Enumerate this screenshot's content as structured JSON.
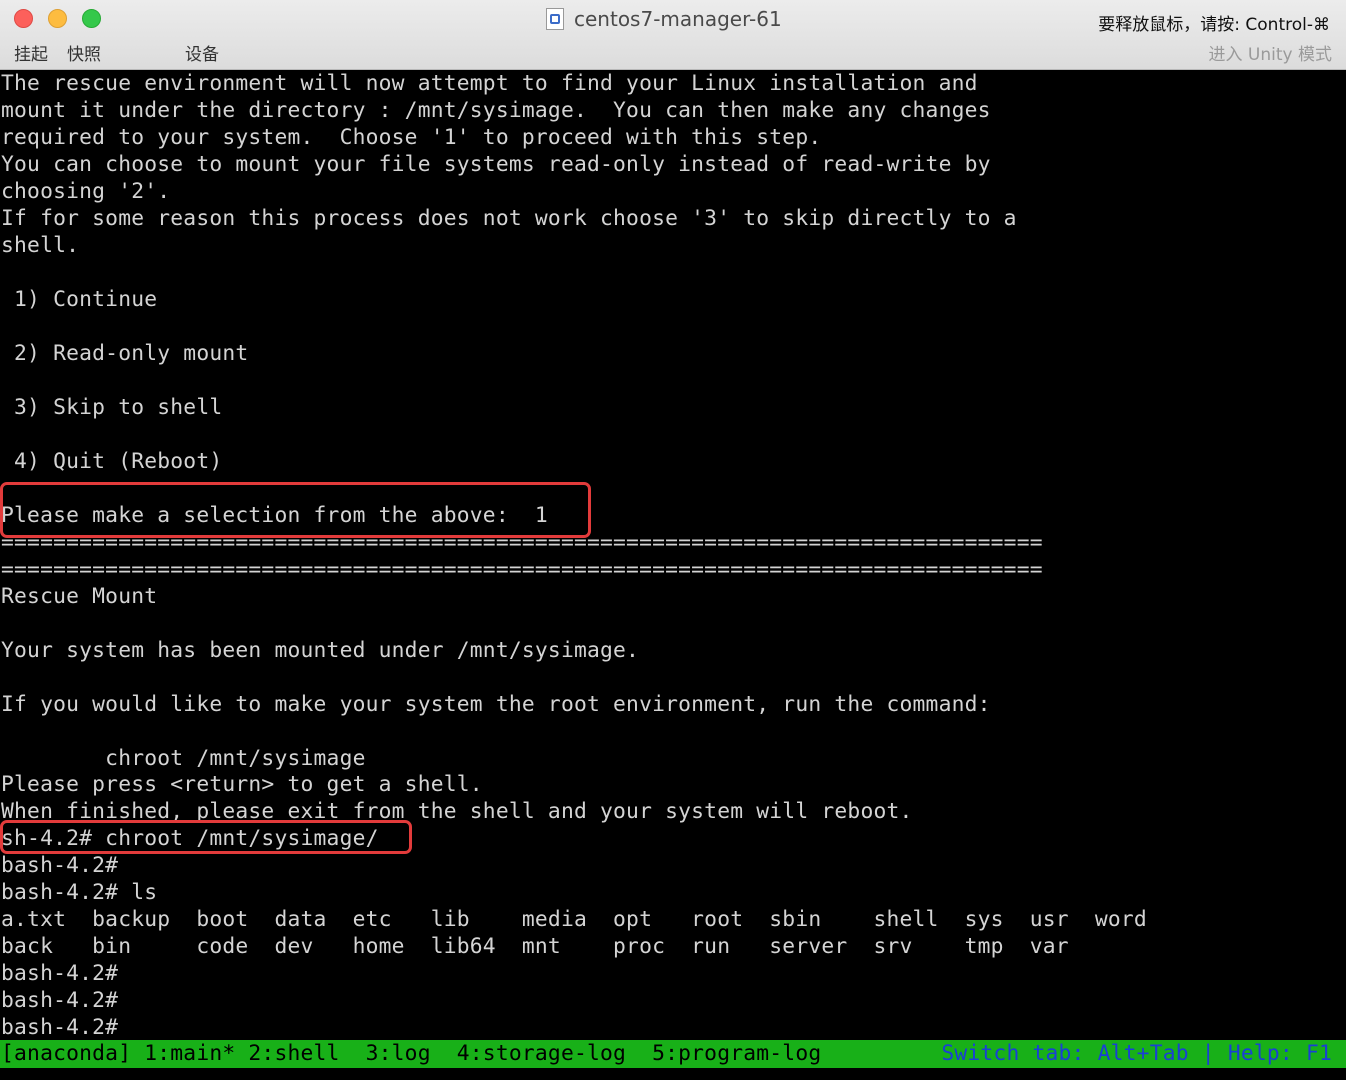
{
  "window": {
    "title": "centos7-manager-61",
    "release_hint": "要释放鼠标，请按: Control-⌘",
    "menu": [
      "挂起",
      "快照",
      "设备"
    ],
    "unity_mode": "进入 Unity 模式"
  },
  "terminal": {
    "lines": [
      "The rescue environment will now attempt to find your Linux installation and",
      "mount it under the directory : /mnt/sysimage.  You can then make any changes",
      "required to your system.  Choose '1' to proceed with this step.",
      "You can choose to mount your file systems read-only instead of read-write by",
      "choosing '2'.",
      "If for some reason this process does not work choose '3' to skip directly to a",
      "shell.",
      "",
      " 1) Continue",
      "",
      " 2) Read-only mount",
      "",
      " 3) Skip to shell",
      "",
      " 4) Quit (Reboot)",
      "",
      "Please make a selection from the above:  1",
      "================================================================================",
      "================================================================================",
      "Rescue Mount",
      "",
      "Your system has been mounted under /mnt/sysimage.",
      "",
      "If you would like to make your system the root environment, run the command:",
      "",
      "        chroot /mnt/sysimage",
      "Please press <return> to get a shell.",
      "When finished, please exit from the shell and your system will reboot.",
      "sh-4.2# chroot /mnt/sysimage/",
      "bash-4.2#",
      "bash-4.2# ls",
      "a.txt  backup  boot  data  etc   lib    media  opt   root  sbin    shell  sys  usr  word",
      "back   bin     code  dev   home  lib64  mnt    proc  run   server  srv    tmp  var",
      "bash-4.2#",
      "bash-4.2#",
      "bash-4.2#"
    ]
  },
  "status_bar": {
    "left": "[anaconda] 1:main* 2:shell  3:log  4:storage-log  5:program-log",
    "right": "Switch tab: Alt+Tab | Help: F1"
  },
  "colors": {
    "terminal_bg": "#000000",
    "terminal_fg": "#d4d4d4",
    "status_bg": "#18b018",
    "status_right_fg": "#1a3fd6",
    "highlight": "#e23b3b"
  }
}
